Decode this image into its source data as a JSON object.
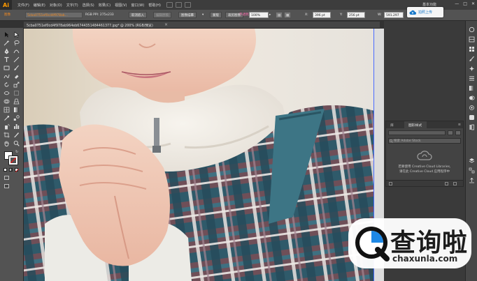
{
  "app": {
    "logo": "Ai",
    "menu": [
      "文件(F)",
      "编辑(E)",
      "对象(O)",
      "文字(T)",
      "选择(S)",
      "效果(C)",
      "视图(V)",
      "窗口(W)",
      "帮助(H)"
    ],
    "workspace": "基本功能",
    "window_controls": [
      "—",
      "□",
      "✕"
    ]
  },
  "control_bar": {
    "label": "图像",
    "filename_short": "5cba0751ef0cd4f978ab...",
    "color_mode": "RGB  PPI:  275x233",
    "embed_button": "取消嵌入",
    "edit_original": "编辑原稿",
    "image_trace": "图像描摹",
    "mask": "蒙版",
    "crop": "裁剪图像",
    "opacity_label": "不透明度",
    "opacity_value": "100%",
    "x_label": "X:",
    "x_value": "396 pt",
    "y_label": "Y:",
    "y_value": "256 pt",
    "w_label": "W:",
    "w_value": "591.297",
    "upload_label": "拍照上传"
  },
  "document": {
    "tab_label": "5cba0751ef0cd4f978ab964eb6744351484461377.jpg* @ 200% (RGB/预览)",
    "close": "×"
  },
  "libraries_panel": {
    "tabs": [
      "库",
      "图形样式"
    ],
    "menu_icon": "≡",
    "search_placeholder": "搜索 Adobe Stock",
    "message_line1": "若要使用 Creative Cloud Libraries,",
    "message_line2": "请在此 Creative Cloud 应用程序中"
  },
  "watermark": {
    "brand": "查询啦",
    "url": "chaxunla.com"
  },
  "colors": {
    "accent_orange": "#f08a24",
    "ai_logo": "#ff9a00",
    "upload_blue": "#1979c9",
    "artboard_edge": "#4a6cff"
  }
}
